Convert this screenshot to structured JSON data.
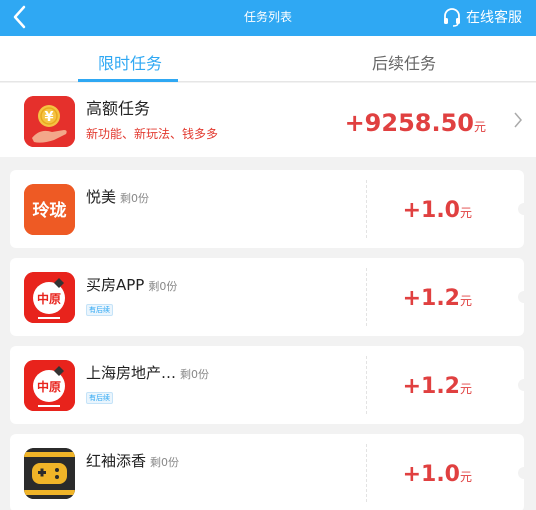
{
  "topbar": {
    "title": "任务列表",
    "service_label": "在线客服"
  },
  "tabs": [
    {
      "label": "限时任务",
      "active": true
    },
    {
      "label": "后续任务",
      "active": false
    }
  ],
  "high_task": {
    "name": "高额任务",
    "desc": "新功能、新玩法、钱多多",
    "reward_value": "+9258.50",
    "reward_unit": "元",
    "coin_symbol": "¥"
  },
  "tasks": [
    {
      "name": "悦美",
      "remain": "剩0份",
      "badge": "",
      "reward_value": "+1.0",
      "reward_unit": "元",
      "icon": "yuemei-logo-icon",
      "icon_text": "玲珑"
    },
    {
      "name": "买房APP",
      "remain": "剩0份",
      "badge": "有后续",
      "reward_value": "+1.2",
      "reward_unit": "元",
      "icon": "zhongyuan-logo-icon",
      "icon_text": "中原"
    },
    {
      "name": "上海房地产…",
      "remain": "剩0份",
      "badge": "有后续",
      "reward_value": "+1.2",
      "reward_unit": "元",
      "icon": "zhongyuan-logo-icon",
      "icon_text": "中原"
    },
    {
      "name": "红袖添香",
      "remain": "剩0份",
      "badge": "",
      "reward_value": "+1.0",
      "reward_unit": "元",
      "icon": "game-controller-icon"
    }
  ],
  "colors": {
    "primary": "#2fa8f3",
    "reward": "#e04040",
    "background": "#f2f2f2"
  }
}
